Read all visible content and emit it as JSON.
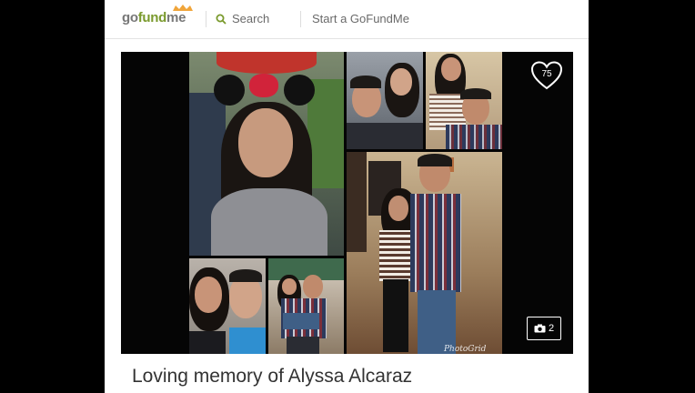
{
  "header": {
    "logo_prefix": "go",
    "logo_fund": "fund",
    "logo_suffix": "me",
    "search_label": "Search",
    "start_label": "Start a GoFundMe"
  },
  "hero": {
    "heart_count": "75",
    "photo_count": "2",
    "watermark": "PhotoGrid"
  },
  "campaign": {
    "title": "Loving memory of Alyssa Alcaraz"
  },
  "colors": {
    "brand_green": "#7a9a2d",
    "logo_crown": "#f0a53a",
    "page_bg": "#000000"
  }
}
